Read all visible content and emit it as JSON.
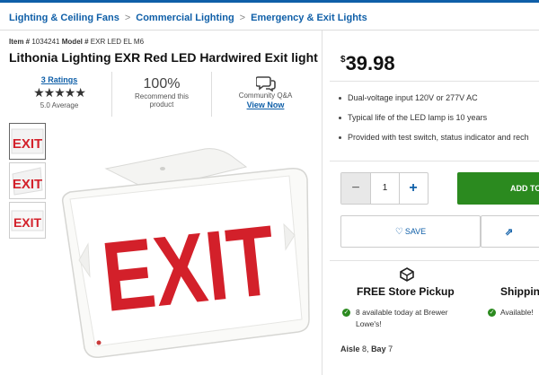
{
  "breadcrumb": [
    "Lighting & Ceiling Fans",
    "Commercial Lighting",
    "Emergency & Exit Lights"
  ],
  "item": {
    "item_label": "Item #",
    "item_number": "1034241",
    "model_label": "Model #",
    "model_number": "EXR LED EL M6"
  },
  "product_title": "Lithonia Lighting EXR Red LED Hardwired Exit light",
  "ratings": {
    "count_text": "3 Ratings",
    "stars": "★★★★★",
    "average_text": "5.0 Average",
    "star_value": 5.0
  },
  "recommend": {
    "percent": "100%",
    "line1": "Recommend this",
    "line2": "product"
  },
  "qa": {
    "label": "Community Q&A",
    "link": "View Now",
    "icon": "chat-bubbles-icon"
  },
  "image_text": "EXIT",
  "price": {
    "currency": "$",
    "amount": "39.98"
  },
  "features": [
    "Dual-voltage input 120V or 277V AC",
    "Typical life of the LED lamp is 10 years",
    "Provided with test switch, status indicator and rech"
  ],
  "quantity": {
    "minus": "−",
    "value": "1",
    "plus": "+"
  },
  "add_to_cart": "ADD TO",
  "save_label": "SAVE",
  "fulfillment": {
    "pickup_title": "FREE Store Pickup",
    "pickup_line1": "8 available today at Brewer",
    "pickup_line2": "Lowe's!",
    "ship_title": "Shippin",
    "ship_line1": "Available!"
  },
  "aisle": {
    "aisle_label": "Aisle",
    "aisle_value": "8",
    "bay_label": "Bay",
    "bay_value": "7"
  },
  "colors": {
    "brand_blue": "#0f5fa8",
    "cart_green": "#2b8a1f",
    "exit_red": "#d3202a"
  }
}
